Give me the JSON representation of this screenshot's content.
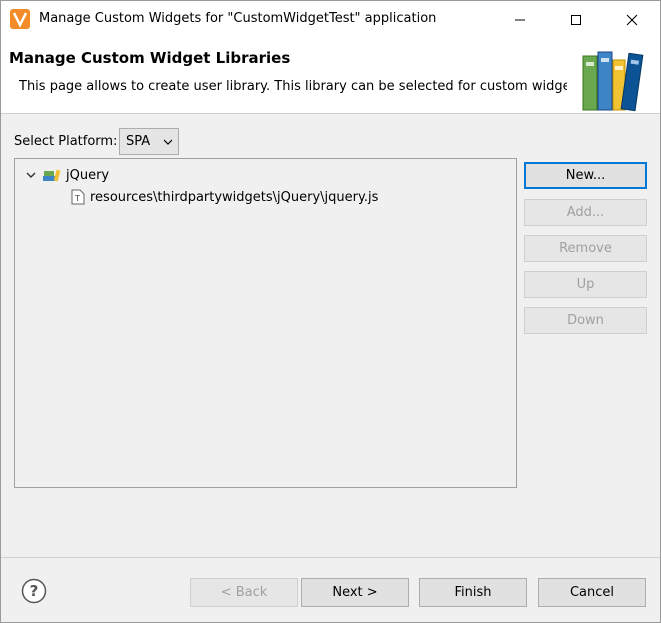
{
  "window": {
    "title": "Manage Custom Widgets for \"CustomWidgetTest\" application",
    "app_icon": "app-logo-icon",
    "controls": {
      "minimize": "minimize-icon",
      "maximize": "maximize-icon",
      "close": "close-icon"
    }
  },
  "banner": {
    "title": "Manage Custom Widget Libraries",
    "description": "This page allows to create user library. This library can be selected for custom widget.",
    "image": "books-illustration"
  },
  "platform": {
    "label": "Select Platform:",
    "selected": "SPA"
  },
  "tree": {
    "library": {
      "label": "jQuery",
      "icon": "library-icon",
      "expanded": true
    },
    "files": [
      {
        "label": "resources\\thirdpartywidgets\\jQuery\\jquery.js",
        "icon": "text-file-icon"
      }
    ]
  },
  "side_buttons": {
    "new": "New...",
    "add": "Add...",
    "remove": "Remove",
    "up": "Up",
    "down": "Down"
  },
  "footer": {
    "help_icon": "help-icon",
    "back": "< Back",
    "next": "Next >",
    "finish": "Finish",
    "cancel": "Cancel"
  },
  "colors": {
    "accent": "#0078d7",
    "app_icon": "#f28c28",
    "window_bg": "#f0f0f0"
  }
}
